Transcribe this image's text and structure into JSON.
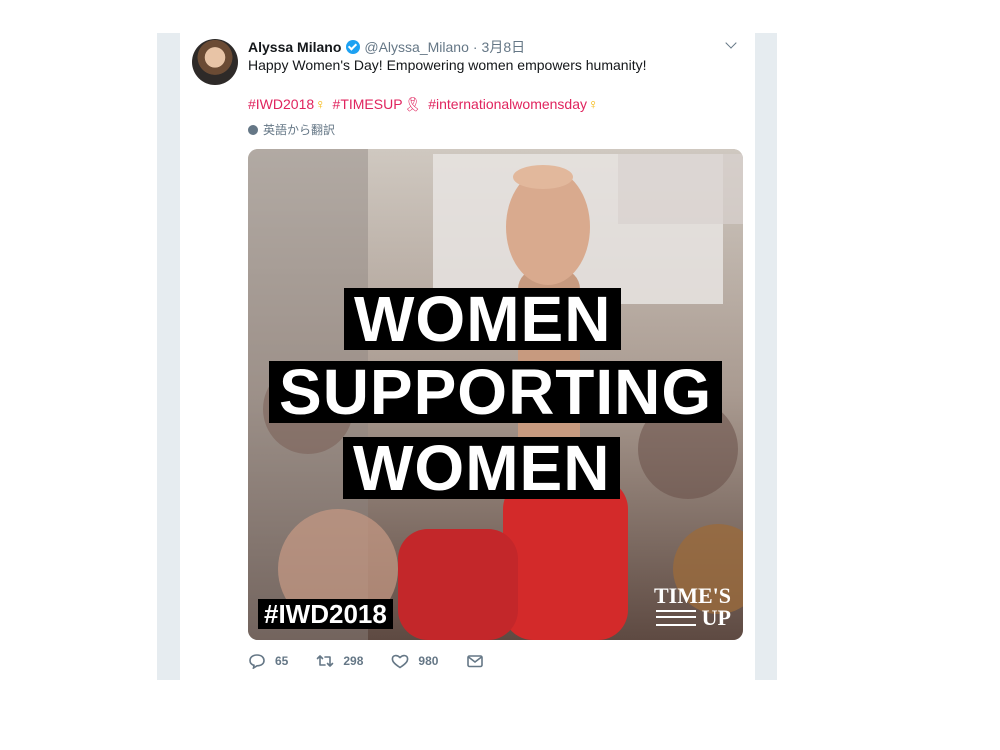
{
  "tweet": {
    "name": "Alyssa Milano",
    "handle": "@Alyssa_Milano",
    "separator": "·",
    "date": "3月8日",
    "text": "Happy Women's Day! Empowering women empowers humanity!",
    "hashtags": [
      "#IWD2018",
      "#TIMESUP",
      "#internationalwomensday"
    ],
    "emoji": {
      "venus": "♀",
      "ribbon": "🎗"
    },
    "translate_label": "英語から翻訳"
  },
  "media": {
    "lines": [
      "WOMEN",
      "SUPPORTING",
      "WOMEN"
    ],
    "corner_tag": "#IWD2018",
    "logo_top": "TIME'S",
    "logo_bottom": "UP"
  },
  "actions": {
    "replies": "65",
    "retweets": "298",
    "likes": "980"
  },
  "icons": [
    "verified-badge-icon",
    "chevron-down-icon",
    "globe-icon",
    "reply-icon",
    "retweet-icon",
    "like-icon",
    "message-icon"
  ],
  "colors": {
    "link": "#e0245e",
    "muted": "#657786",
    "verified": "#1da1f2",
    "gutter": "#e6ecf0"
  }
}
